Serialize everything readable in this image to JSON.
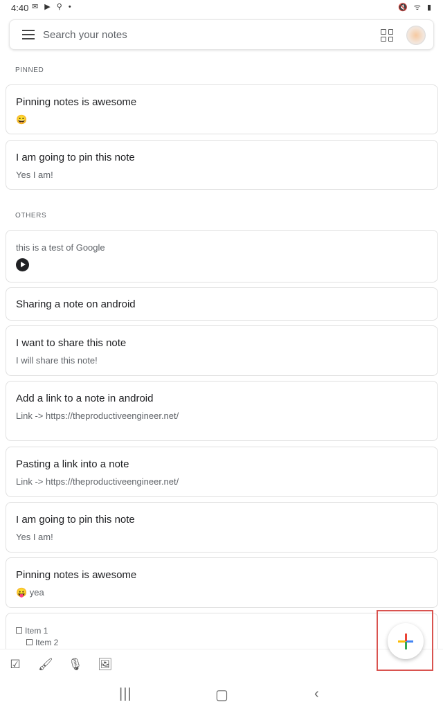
{
  "status": {
    "time": "4:40",
    "left_icons": "✉ ▶ ⚲ •",
    "right_icons": "🔇 ᯤ ▮"
  },
  "search": {
    "placeholder": "Search your notes",
    "menu_icon": "menu-icon",
    "layout_icon": "grid-view-icon"
  },
  "sections": {
    "pinned": "PINNED",
    "others": "OTHERS"
  },
  "pinned": [
    {
      "title": "Pinning notes is awesome",
      "body": "😀"
    },
    {
      "title": "I am going to pin this note",
      "body": "Yes I am!"
    }
  ],
  "others": [
    {
      "body": "this is a test of Google"
    },
    {
      "title": "Sharing a note on android"
    },
    {
      "title": "I want to share this note",
      "body": "I will share this note!"
    },
    {
      "title": "Add a link to a note in android",
      "body": "Link -> https://theproductiveengineer.net/"
    },
    {
      "title": "Pasting a link into a note",
      "body": "Link -> https://theproductiveengineer.net/"
    },
    {
      "title": "I am going to pin this note",
      "body": "Yes I am!"
    },
    {
      "title": "Pinning notes is awesome",
      "body": "😛 yea"
    },
    {
      "items": [
        "Item 1",
        "Item 2"
      ]
    }
  ],
  "colors": {
    "fab_red": "#ea4335",
    "fab_yellow": "#fbbc04",
    "fab_blue": "#4285f4",
    "fab_green": "#34a853",
    "highlight": "#d9534f"
  }
}
